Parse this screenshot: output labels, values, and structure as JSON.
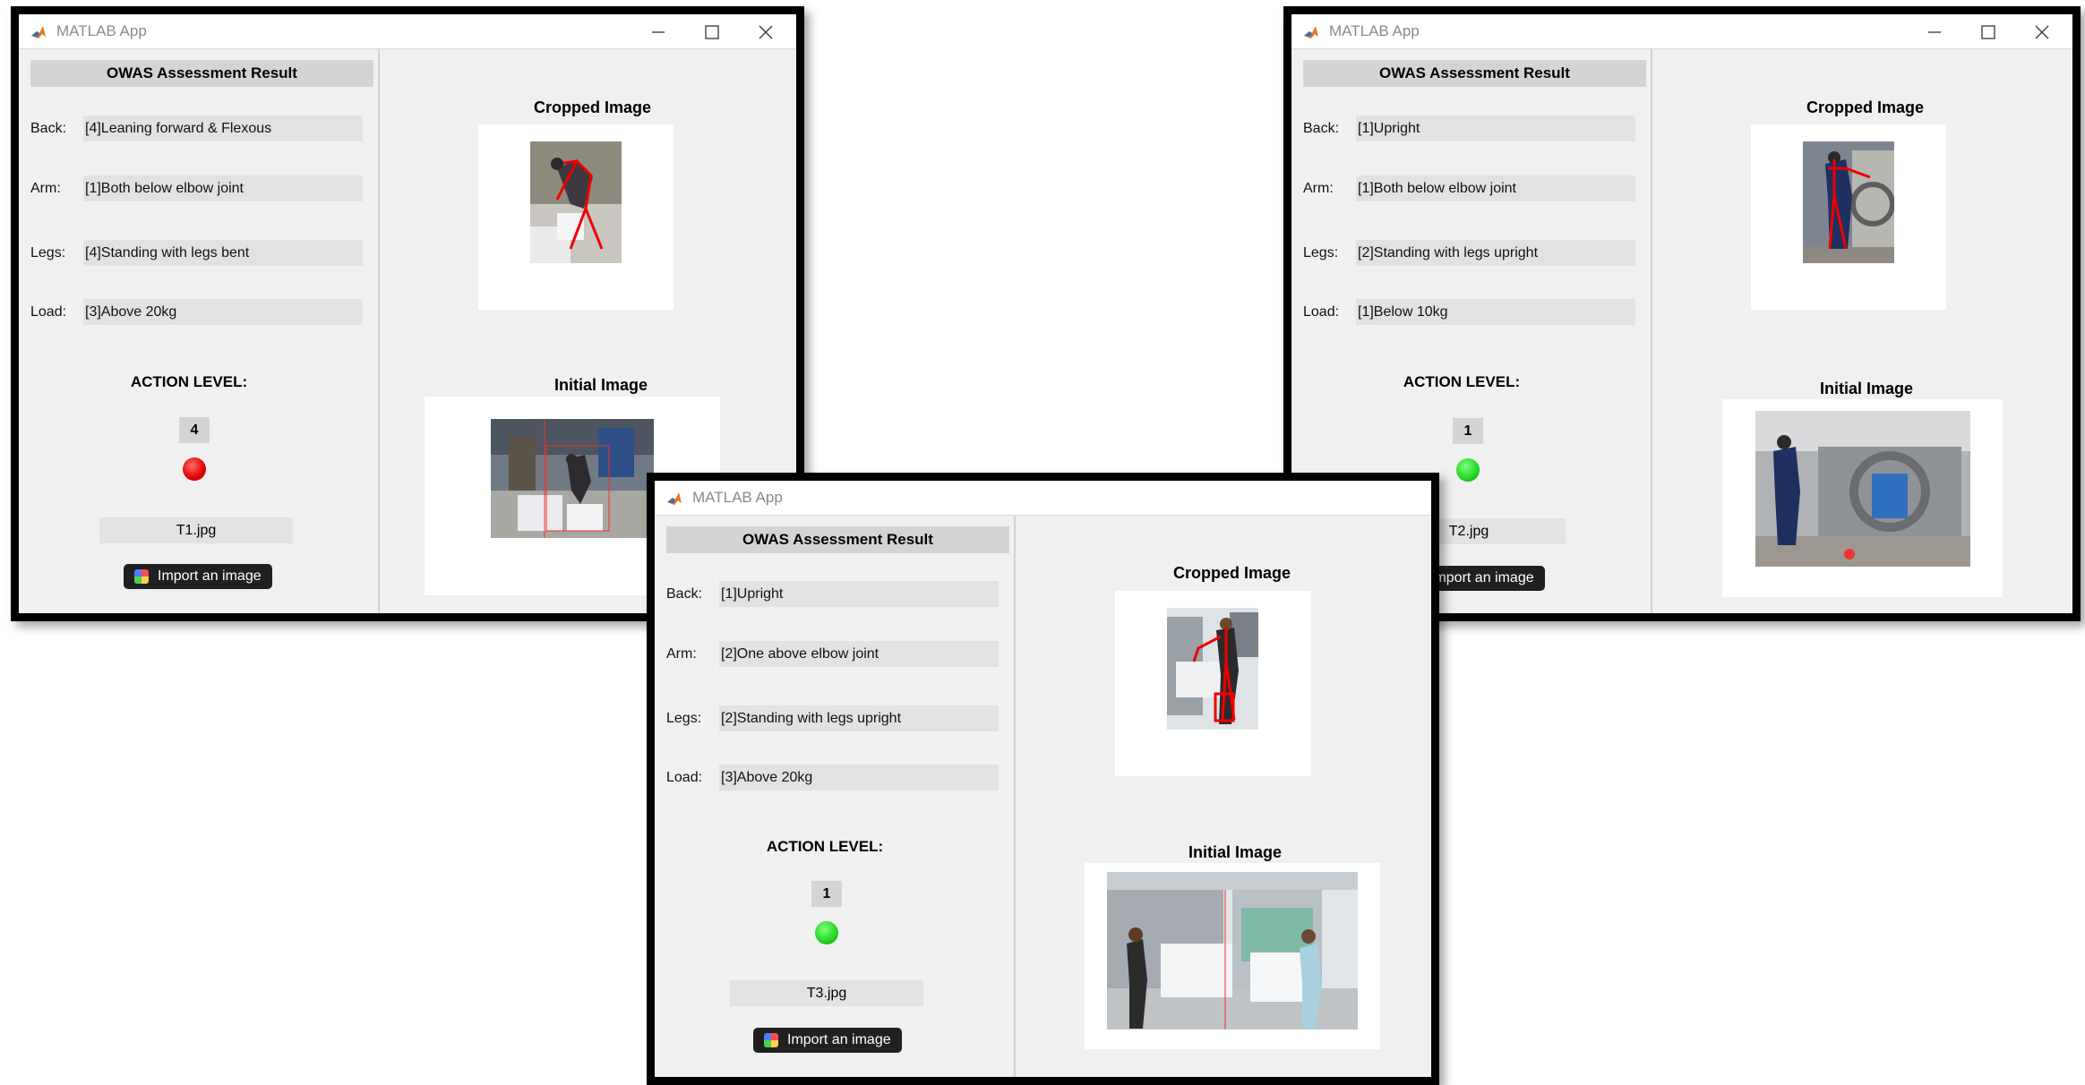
{
  "app_title": "MATLAB App",
  "panel_title": "OWAS Assessment Result",
  "labels": {
    "back": "Back:",
    "arm": "Arm:",
    "legs": "Legs:",
    "load": "Load:",
    "action_level": "ACTION LEVEL:",
    "import_button": "Import an image",
    "cropped_image": "Cropped Image",
    "initial_image": "Initial Image"
  },
  "windows": [
    {
      "back": "[4]Leaning forward & Flexous",
      "arm": "[1]Both below elbow joint",
      "legs": "[4]Standing with legs bent",
      "load": "[3]Above 20kg",
      "action_level": "4",
      "lamp_color": "#e00000",
      "filename": "T1.jpg"
    },
    {
      "back": "[1]Upright",
      "arm": "[1]Both below elbow joint",
      "legs": "[2]Standing with legs upright",
      "load": "[1]Below 10kg",
      "action_level": "1",
      "lamp_color": "#22d422",
      "filename": "T2.jpg"
    },
    {
      "back": "[1]Upright",
      "arm": "[2]One above elbow joint",
      "legs": "[2]Standing with legs upright",
      "load": "[3]Above 20kg",
      "action_level": "1",
      "lamp_color": "#22d422",
      "filename": "T3.jpg"
    }
  ]
}
